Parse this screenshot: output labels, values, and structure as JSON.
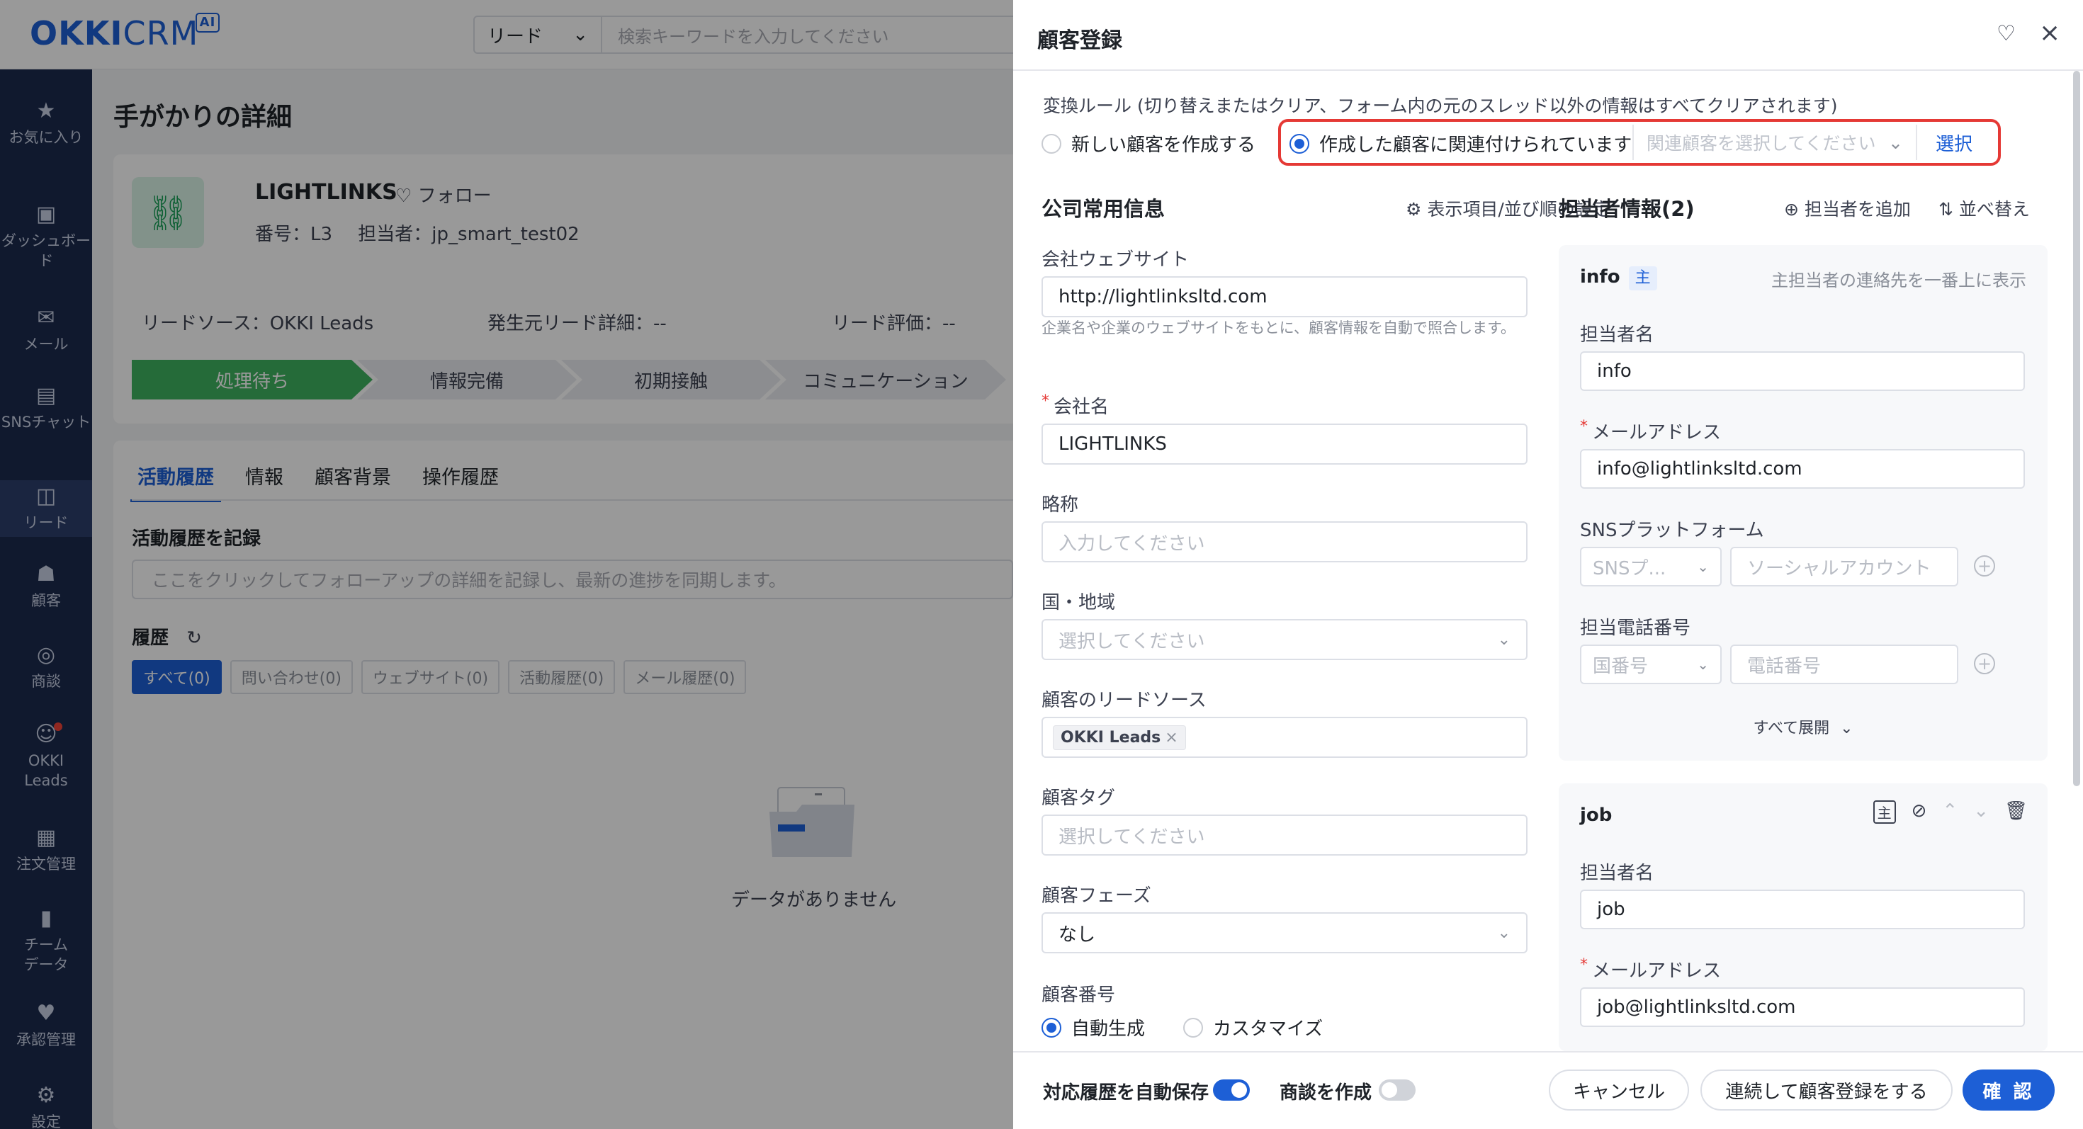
{
  "app": {
    "logo_main": "OKKI",
    "logo_crm": "CRM",
    "logo_ai": "AI",
    "search_scope": "リード",
    "search_placeholder": "検索キーワードを入力してください"
  },
  "sidebar": {
    "items": [
      {
        "label": "お気に入り",
        "icon": "star-icon"
      },
      {
        "label": "ダッシュボード",
        "icon": "dashboard-icon"
      },
      {
        "label": "メール",
        "icon": "mail-icon"
      },
      {
        "label": "SNSチャット",
        "icon": "chat-icon"
      },
      {
        "label": "リード",
        "icon": "leads-icon"
      },
      {
        "label": "顧客",
        "icon": "customers-icon"
      },
      {
        "label": "商談",
        "icon": "target-icon"
      },
      {
        "label": "OKKI Leads",
        "icon": "okki-leads-icon"
      },
      {
        "label": "注文管理",
        "icon": "orders-icon"
      },
      {
        "label": "チームデータ",
        "icon": "bar-chart-icon"
      },
      {
        "label": "承認管理",
        "icon": "approval-icon"
      },
      {
        "label": "設定",
        "icon": "settings-icon"
      }
    ]
  },
  "background": {
    "page_title": "手がかりの詳細",
    "lead_name": "LIGHTLINKS",
    "follow": "フォロー",
    "number": "番号：L3",
    "owner": "担当者：jp_smart_test02",
    "lead_source": "リードソース：OKKI Leads",
    "origin_detail": "発生元リード詳細：--",
    "lead_rating": "リード評価：--",
    "stages": [
      "処理待ち",
      "情報完備",
      "初期接触",
      "コミュニケーション"
    ],
    "tabs": [
      "活動履歴",
      "情報",
      "顧客背景",
      "操作履歴"
    ],
    "record_title": "活動履歴を記録",
    "record_placeholder": "ここをクリックしてフォローアップの詳細を記録し、最新の進捗を同期します。",
    "history_title": "履歴",
    "filters": [
      "すべて(0)",
      "問い合わせ(0)",
      "ウェブサイト(0)",
      "活動履歴(0)",
      "メール履歴(0)"
    ],
    "empty_text": "データがありません"
  },
  "drawer": {
    "title": "顧客登録",
    "rule_text": "変換ルール (切り替えまたはクリア、フォーム内の元のスレッド以外の情報はすべてクリアされます)",
    "option_new": "新しい顧客を作成する",
    "option_linked": "作成した顧客に関連付けられています",
    "linked_placeholder": "関連顧客を選択してください",
    "linked_button": "選択",
    "company_section": "公司常用信息",
    "display_settings": "表示項目/並び順の設定",
    "fields": {
      "website_label": "会社ウェブサイト",
      "website_value": "http://lightlinksltd.com",
      "website_hint": "企業名や企業のウェブサイトをもとに、顧客情報を自動で照合します。",
      "company_label": "会社名",
      "company_value": "LIGHTLINKS",
      "short_label": "略称",
      "short_placeholder": "入力してください",
      "country_label": "国・地域",
      "country_placeholder": "選択してください",
      "source_label": "顧客のリードソース",
      "source_tag": "OKKI Leads",
      "tag_label": "顧客タグ",
      "tag_placeholder": "選択してください",
      "phase_label": "顧客フェーズ",
      "phase_value": "なし",
      "number_label": "顧客番号",
      "number_auto": "自動生成",
      "number_custom": "カスタマイズ"
    },
    "contact_section": "担当者情報(2)",
    "add_contact": "担当者を追加",
    "sort": "並べ替え",
    "contacts": [
      {
        "name": "info",
        "primary_badge": "主",
        "primary_hint": "主担当者の連絡先を一番上に表示",
        "name_label": "担当者名",
        "name_value": "info",
        "email_label": "メールアドレス",
        "email_value": "info@lightlinksltd.com",
        "sns_label": "SNSプラットフォーム",
        "sns_platform_placeholder": "SNSプ...",
        "sns_account_placeholder": "ソーシャルアカウント",
        "phone_label": "担当電話番号",
        "country_code_placeholder": "国番号",
        "phone_placeholder": "電話番号",
        "expand_all": "すべて展開"
      },
      {
        "name": "job",
        "name_label": "担当者名",
        "name_value": "job",
        "email_label": "メールアドレス",
        "email_value": "job@lightlinksltd.com"
      }
    ],
    "footer": {
      "autosave_label": "対応履歴を自動保存",
      "create_deal_label": "商談を作成",
      "cancel": "キャンセル",
      "continue": "連続して顧客登録をする",
      "confirm": "確 認"
    }
  }
}
